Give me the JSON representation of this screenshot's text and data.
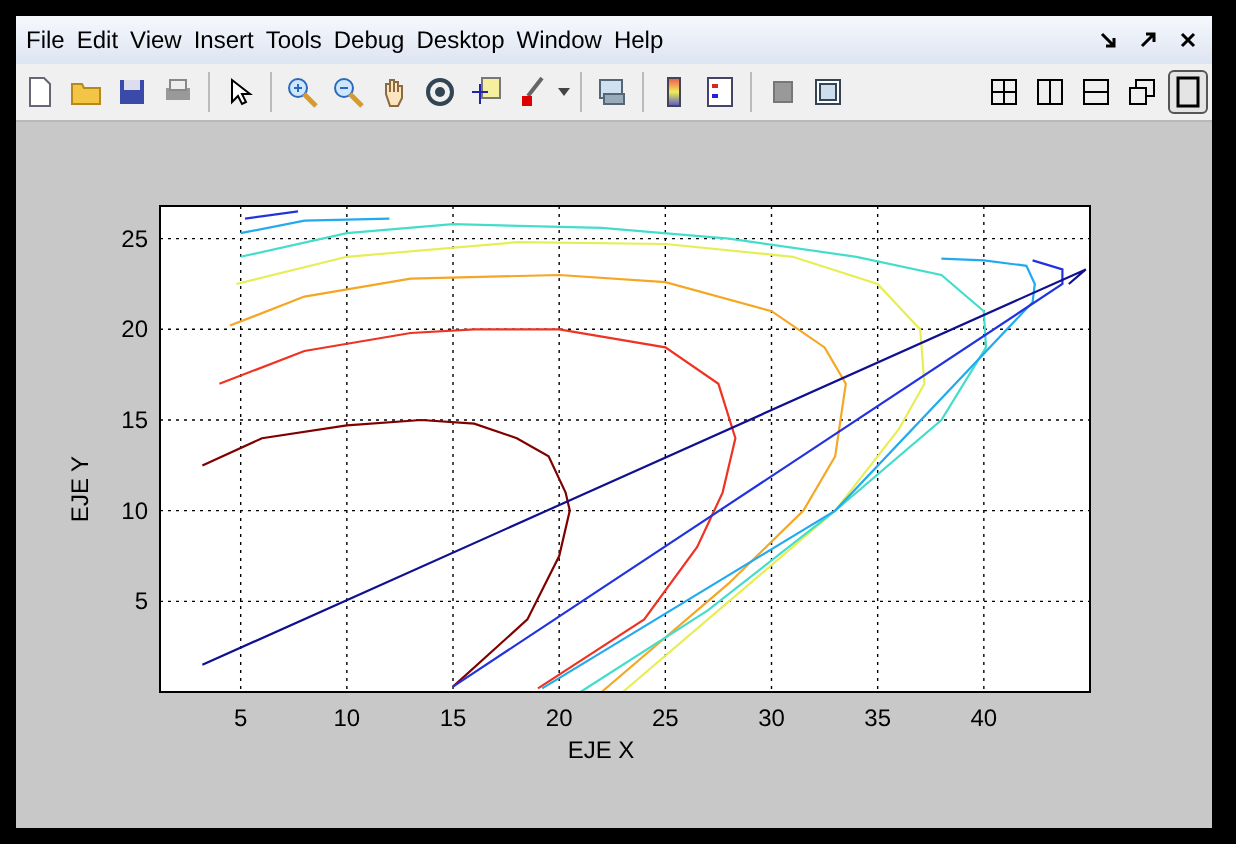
{
  "menu_bar": {
    "items": [
      "File",
      "Edit",
      "View",
      "Insert",
      "Tools",
      "Debug",
      "Desktop",
      "Window",
      "Help"
    ]
  },
  "toolbar": {
    "layout_buttons": [
      {
        "kind": "tile",
        "selected": false
      },
      {
        "kind": "columns",
        "selected": false
      },
      {
        "kind": "rows",
        "selected": false
      },
      {
        "kind": "float",
        "selected": false
      },
      {
        "kind": "single",
        "selected": true
      }
    ]
  },
  "figure": {
    "chart_data": {
      "type": "line",
      "xlabel": "EJE X",
      "ylabel": "EJE Y",
      "xlim": [
        1.2,
        45
      ],
      "ylim": [
        0,
        26.8
      ],
      "xticks": [
        5,
        10,
        15,
        20,
        25,
        30,
        35,
        40
      ],
      "yticks": [
        5,
        10,
        15,
        20,
        25
      ],
      "grid": true,
      "series": [
        {
          "color": "#800000",
          "x": [
            3.2,
            6,
            10,
            13.5,
            16,
            18,
            19.5,
            20.3,
            20.5,
            20,
            18.5,
            15
          ],
          "values": [
            12.5,
            14,
            14.7,
            15,
            14.8,
            14,
            13,
            11,
            10,
            7.5,
            4,
            0.3
          ]
        },
        {
          "color": "#ee3322",
          "x": [
            4,
            8,
            13,
            16,
            20,
            25,
            27.5,
            28.3,
            27.7,
            26.5,
            24,
            19
          ],
          "values": [
            17,
            18.8,
            19.8,
            20,
            20,
            19,
            17,
            14,
            11,
            8,
            4,
            0.2
          ]
        },
        {
          "color": "#f5a623",
          "x": [
            4.5,
            8,
            13,
            20,
            25,
            30,
            32.5,
            33.5,
            33,
            31.5,
            28,
            22
          ],
          "values": [
            20.2,
            21.8,
            22.8,
            23,
            22.6,
            21,
            19,
            17,
            13,
            10,
            6,
            0
          ]
        },
        {
          "color": "#e6ee55",
          "x": [
            4.8,
            10,
            18,
            25,
            31,
            35,
            37,
            37.2,
            36,
            33,
            28,
            23
          ],
          "values": [
            22.5,
            24,
            24.8,
            24.7,
            24,
            22.5,
            20,
            17,
            14.5,
            10,
            5,
            0
          ]
        },
        {
          "color": "#44ddcc",
          "x": [
            5,
            10,
            15,
            22,
            28,
            34,
            38,
            40,
            40.1,
            38,
            33,
            27,
            21
          ],
          "values": [
            24,
            25.3,
            25.8,
            25.6,
            25,
            24,
            23,
            21,
            19,
            15,
            10,
            4.5,
            0
          ]
        },
        {
          "color": "#22aaee",
          "x": [
            5,
            8,
            12,
            null,
            38,
            40,
            42,
            42.4,
            42.3,
            33,
            19.2
          ],
          "values": [
            25.3,
            26,
            26.1,
            null,
            23.9,
            23.8,
            23.5,
            22.5,
            21.5,
            10,
            0.2
          ]
        },
        {
          "color": "#2233dd",
          "x": [
            5.2,
            7.7,
            null,
            42.3,
            43.7,
            43.7,
            15
          ],
          "values": [
            26.1,
            26.5,
            null,
            23.8,
            23.3,
            22.5,
            0.3
          ]
        },
        {
          "color": "#101090",
          "x": [
            3.2,
            44.8,
            44
          ],
          "values": [
            1.5,
            23.3,
            22.5
          ]
        }
      ]
    }
  }
}
